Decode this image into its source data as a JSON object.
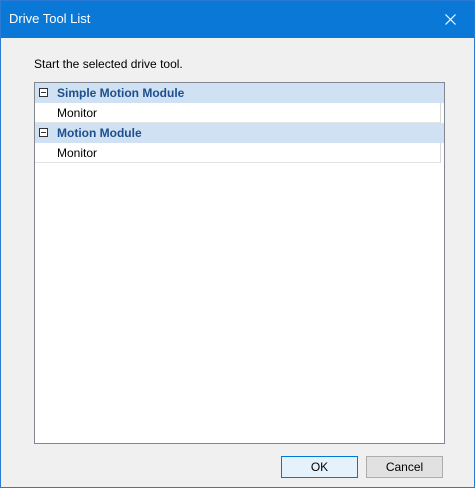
{
  "window": {
    "title": "Drive Tool List",
    "close_icon": "close-icon"
  },
  "instruction": "Start the selected drive tool.",
  "list": {
    "groups": [
      {
        "label": "Simple Motion Module",
        "expanded": true,
        "items": [
          {
            "label": "Monitor"
          }
        ]
      },
      {
        "label": "Motion Module",
        "expanded": true,
        "items": [
          {
            "label": "Monitor"
          }
        ]
      }
    ]
  },
  "buttons": {
    "ok": "OK",
    "cancel": "Cancel"
  },
  "colors": {
    "titlebar": "#0a78d7",
    "group_row_bg": "#cfe1f3",
    "group_text": "#1e4f8d"
  }
}
